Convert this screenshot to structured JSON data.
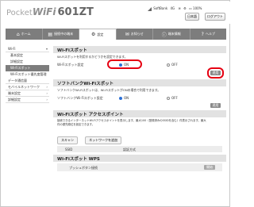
{
  "header": {
    "brand_prefix": "Pocket",
    "brand_name": "WiFi",
    "model": "601ZT",
    "carrier": "SoftBank",
    "network": "4G",
    "battery": "100%",
    "language_label": "日本語",
    "logout_label": "ログアウト"
  },
  "nav": {
    "tabs": [
      {
        "icon": "⌂",
        "label": "ホーム"
      },
      {
        "icon": "▤",
        "label": "接続中の端末"
      },
      {
        "icon": "⚙",
        "label": "設定"
      },
      {
        "icon": "✉",
        "label": "お知らせ"
      },
      {
        "icon": "ⓘ",
        "label": "端末情報"
      },
      {
        "icon": "?",
        "label": "ヘルプ"
      }
    ]
  },
  "sidebar": {
    "wifi": "Wi-Fi",
    "basic": "基本設定",
    "detail": "詳細設定",
    "wifi_spot": "Wi-Fiスポット",
    "wifi_spot_priority": "Wi-Fiスポット優先度管理",
    "data_usage": "データ通信量",
    "mobile_network": "モバイルネットワーク",
    "device_settings": "端末設定",
    "advanced": "詳細設定"
  },
  "sections": {
    "wifi_spot": {
      "title": "Wi-Fiスポット",
      "description": "Wi-Fiスポットを利用するかどうかを設定できます。",
      "setting_label": "Wi-Fiスポット設定",
      "on_label": "ON",
      "off_label": "OFF",
      "apply_label": "適用"
    },
    "softbank_spot": {
      "title": "ソフトバンクWi-Fiスポット",
      "description": "ソフトバンクWi-Fiスポットは、Wi-FiスポットがONの場合で利用できます。",
      "setting_label": "ソフトバンクWi-Fiスポット設定",
      "on_label": "ON",
      "off_label": "OFF",
      "apply_label": "適用"
    },
    "access_point": {
      "title": "Wi-Fiスポット アクセスポイント",
      "description1": "接続できるインターネットWi-Fiアクセスポイントを表示します。最大100（登録済みのSSIDを含む）件表示されます。最大",
      "description2": "件の優先順位を設定できます。",
      "scan_label": "スキャン",
      "network_add_label": "ネットワークを追加",
      "col_ssid": "SSID",
      "col_auth": "認証方式"
    },
    "wps": {
      "title": "Wi-Fiスポット WPS",
      "push_label": "プッシュボタン接続",
      "start_label": "開始"
    }
  }
}
